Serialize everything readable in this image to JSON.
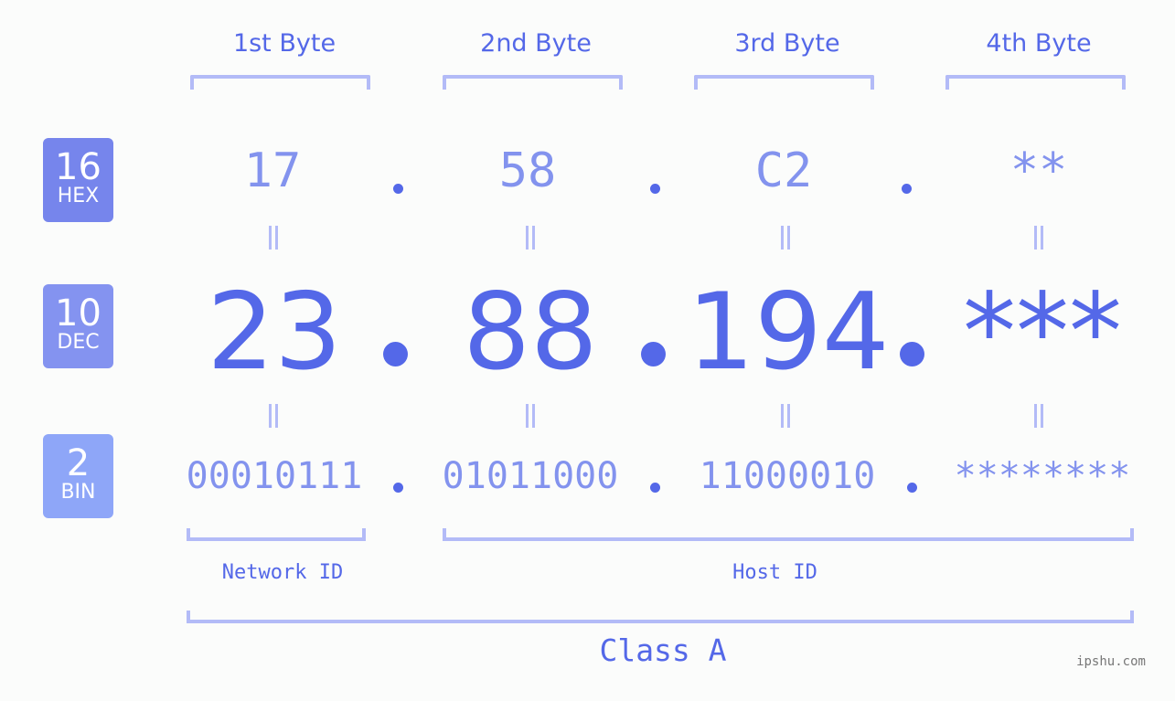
{
  "byte_headers": [
    "1st Byte",
    "2nd Byte",
    "3rd Byte",
    "4th Byte"
  ],
  "bases": [
    {
      "number": "16",
      "name": "HEX",
      "color": "#7685ec"
    },
    {
      "number": "10",
      "name": "DEC",
      "color": "#8493f0"
    },
    {
      "number": "2",
      "name": "BIN",
      "color": "#8ea6f8"
    }
  ],
  "hex_values": [
    "17",
    "58",
    "C2",
    "**"
  ],
  "dec_values": [
    "23",
    "88",
    "194",
    "***"
  ],
  "bin_values": [
    "00010111",
    "01011000",
    "11000010",
    "********"
  ],
  "separator": ".",
  "network_label": "Network ID",
  "host_label": "Host ID",
  "class_label": "Class A",
  "watermark": "ipshu.com",
  "colors": {
    "accent": "#5468e8",
    "light_accent": "#8393ee",
    "bracket": "#b3bbf7",
    "background": "#fbfcfb"
  }
}
